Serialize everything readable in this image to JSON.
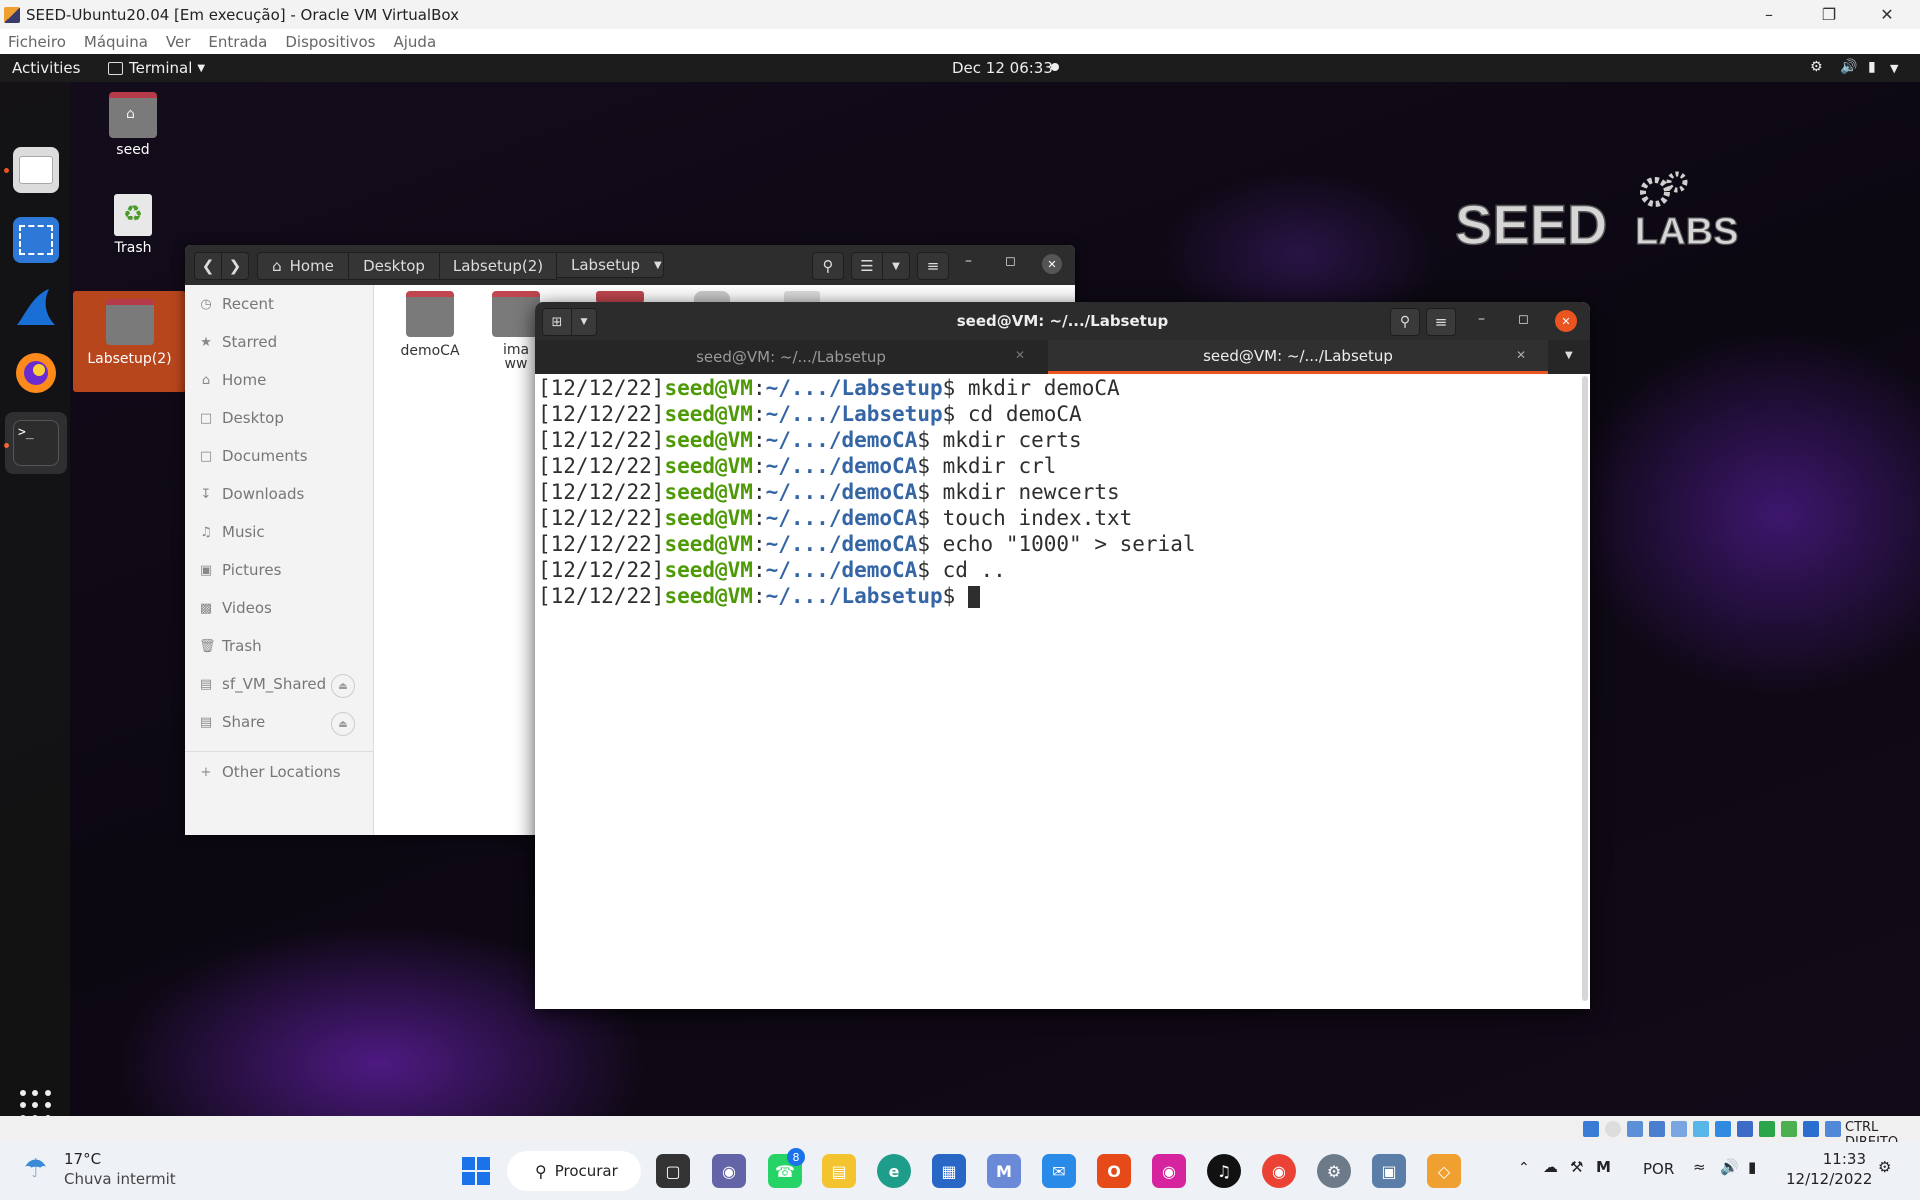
{
  "host": {
    "window_title": "SEED-Ubuntu20.04 [Em execução] - Oracle VM VirtualBox",
    "menu": [
      "Ficheiro",
      "Máquina",
      "Ver",
      "Entrada",
      "Dispositivos",
      "Ajuda"
    ],
    "status_key": "CTRL DIREITO"
  },
  "topbar": {
    "activities": "Activities",
    "app_menu": "Terminal",
    "clock": "Dec 12  06:33"
  },
  "desktop": {
    "icons": [
      "seed",
      "Trash",
      "Labsetup(2)"
    ],
    "logo_text": "SEED LABS"
  },
  "files": {
    "path": [
      "Home",
      "Desktop",
      "Labsetup(2)",
      "Labsetup"
    ],
    "sidebar": [
      "Recent",
      "Starred",
      "Home",
      "Desktop",
      "Documents",
      "Downloads",
      "Music",
      "Pictures",
      "Videos",
      "Trash",
      "sf_VM_Shared",
      "Share",
      "Other Locations"
    ],
    "items": [
      "demoCA",
      "ima",
      "ww"
    ]
  },
  "terminal": {
    "title": "seed@VM: ~/.../Labsetup",
    "tabs": [
      "seed@VM: ~/.../Labsetup",
      "seed@VM: ~/.../Labsetup"
    ],
    "lines": [
      {
        "time": "[12/12/22]",
        "user": "seed@VM",
        "sep": ":",
        "path": "~/.../Labsetup",
        "cmd": "$ mkdir demoCA"
      },
      {
        "time": "[12/12/22]",
        "user": "seed@VM",
        "sep": ":",
        "path": "~/.../Labsetup",
        "cmd": "$ cd demoCA"
      },
      {
        "time": "[12/12/22]",
        "user": "seed@VM",
        "sep": ":",
        "path": "~/.../demoCA",
        "cmd": "$ mkdir certs"
      },
      {
        "time": "[12/12/22]",
        "user": "seed@VM",
        "sep": ":",
        "path": "~/.../demoCA",
        "cmd": "$ mkdir crl"
      },
      {
        "time": "[12/12/22]",
        "user": "seed@VM",
        "sep": ":",
        "path": "~/.../demoCA",
        "cmd": "$ mkdir newcerts"
      },
      {
        "time": "[12/12/22]",
        "user": "seed@VM",
        "sep": ":",
        "path": "~/.../demoCA",
        "cmd": "$ touch index.txt"
      },
      {
        "time": "[12/12/22]",
        "user": "seed@VM",
        "sep": ":",
        "path": "~/.../demoCA",
        "cmd": "$ echo \"1000\" > serial"
      },
      {
        "time": "[12/12/22]",
        "user": "seed@VM",
        "sep": ":",
        "path": "~/.../demoCA",
        "cmd": "$ cd .."
      },
      {
        "time": "[12/12/22]",
        "user": "seed@VM",
        "sep": ":",
        "path": "~/.../Labsetup",
        "cmd": "$ "
      }
    ]
  },
  "taskbar": {
    "weather_temp": "17°C",
    "weather_desc": "Chuva intermit",
    "search": "Procurar",
    "whatsapp_badge": "8",
    "lang": "POR",
    "time": "11:33",
    "date": "12/12/2022"
  }
}
